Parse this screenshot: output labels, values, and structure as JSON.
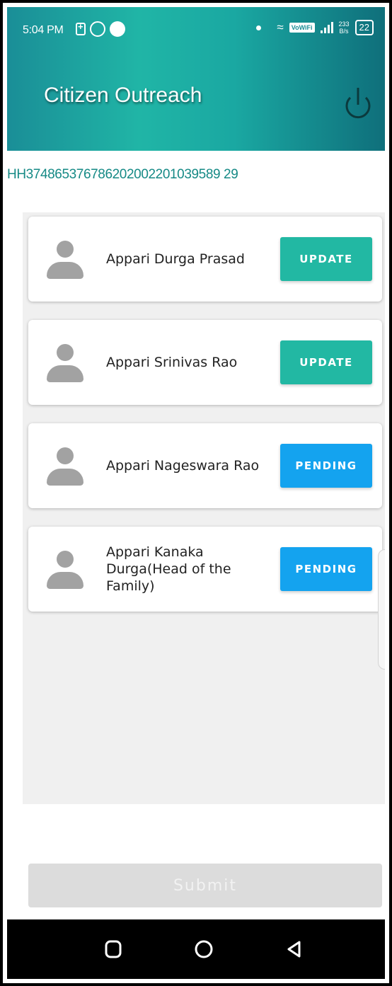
{
  "status_bar": {
    "time": "5:04 PM",
    "vowifi": "VoWiFi",
    "speed_top": "233",
    "speed_bottom": "B/s",
    "battery": "22"
  },
  "header": {
    "title": "Citizen Outreach",
    "power_icon": "power-icon"
  },
  "household_id": "HH374865376786202002201039589 29",
  "members": [
    {
      "name": "Appari Durga Prasad",
      "status": "UPDATE"
    },
    {
      "name": "Appari Srinivas Rao",
      "status": "UPDATE"
    },
    {
      "name": "Appari Nageswara Rao",
      "status": "PENDING"
    },
    {
      "name": "Appari Kanaka Durga(Head of the Family)",
      "status": "PENDING"
    }
  ],
  "submit_label": "Submit",
  "colors": {
    "update": "#22b8a3",
    "pending": "#14a3ef",
    "accent": "#168a86"
  },
  "nav": {
    "recents_icon": "square-icon",
    "home_icon": "circle-icon",
    "back_icon": "triangle-icon"
  }
}
